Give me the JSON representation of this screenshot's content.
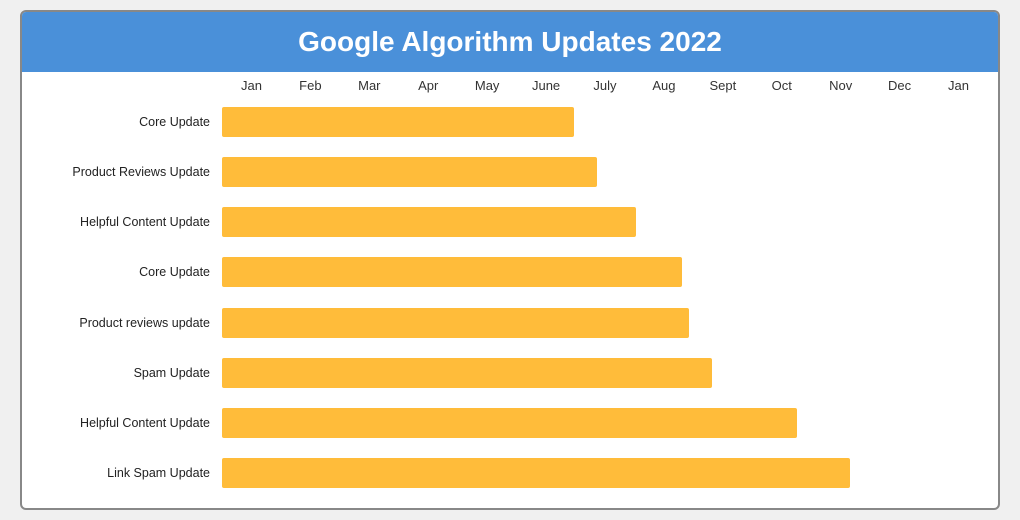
{
  "title": "Google Algorithm Updates 2022",
  "months": [
    "Jan",
    "Feb",
    "Mar",
    "Apr",
    "May",
    "June",
    "July",
    "Aug",
    "Sept",
    "Oct",
    "Nov",
    "Dec",
    "Jan"
  ],
  "bars": [
    {
      "label": "Core Update",
      "widthPct": 46
    },
    {
      "label": "Product Reviews Update",
      "widthPct": 49
    },
    {
      "label": "Helpful Content Update",
      "widthPct": 54
    },
    {
      "label": "Core Update",
      "widthPct": 60
    },
    {
      "label": "Product reviews update",
      "widthPct": 61
    },
    {
      "label": "Spam Update",
      "widthPct": 64
    },
    {
      "label": "Helpful Content Update",
      "widthPct": 75
    },
    {
      "label": "Link Spam Update",
      "widthPct": 82
    }
  ],
  "colors": {
    "header_bg": "#4a90d9",
    "bar_fill": "#FFBC3A"
  }
}
